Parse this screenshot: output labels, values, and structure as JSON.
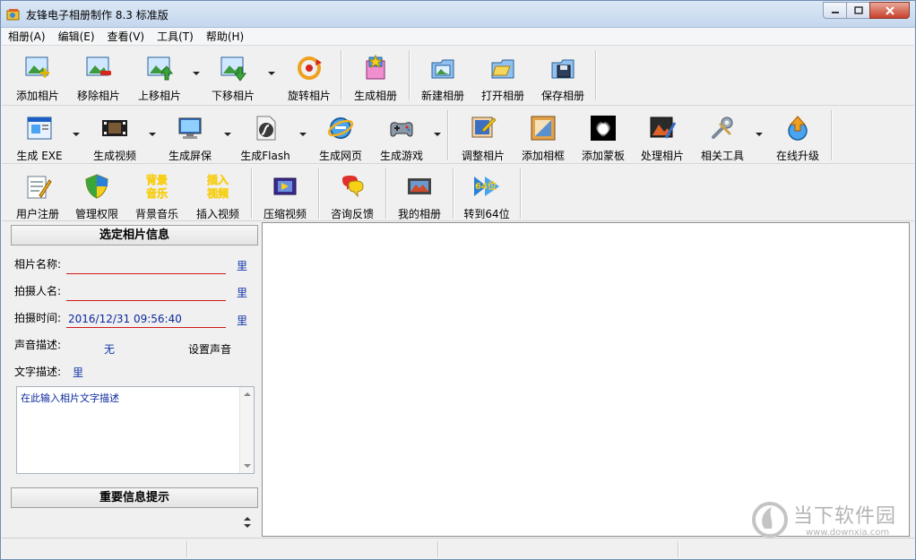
{
  "window": {
    "title": "友锋电子相册制作 8.3 标准版"
  },
  "menu": [
    "相册(A)",
    "编辑(E)",
    "查看(V)",
    "工具(T)",
    "帮助(H)"
  ],
  "toolbar1": {
    "add_photo": "添加相片",
    "remove_photo": "移除相片",
    "move_up": "上移相片",
    "move_down": "下移相片",
    "rotate": "旋转相片",
    "generate_album": "生成相册",
    "new_album": "新建相册",
    "open_album": "打开相册",
    "save_album": "保存相册"
  },
  "toolbar2": {
    "gen_exe": "生成 EXE",
    "gen_video": "生成视频",
    "gen_screensaver": "生成屏保",
    "gen_flash": "生成Flash",
    "gen_webpage": "生成网页",
    "gen_game": "生成游戏",
    "adjust_photo": "调整相片",
    "add_frame": "添加相框",
    "add_mask": "添加蒙板",
    "process_photo": "处理相片",
    "related_tools": "相关工具",
    "online_upgrade": "在线升级"
  },
  "toolbar3": {
    "register": "用户注册",
    "permissions": "管理权限",
    "bg_music": "背景音乐",
    "insert_video": "插入视频",
    "compress_video": "压缩视频",
    "feedback": "咨询反馈",
    "my_album": "我的相册",
    "to_64bit": "转到64位"
  },
  "icon_text": {
    "bg_music_top": "背景",
    "bg_music_bottom": "音乐",
    "insert_video_top": "插入",
    "insert_video_bottom": "视频",
    "bit64": "64位"
  },
  "info_panel": {
    "header": "选定相片信息",
    "name_label": "相片名称:",
    "name_value": "",
    "photographer_label": "拍摄人名:",
    "photographer_value": "",
    "time_label": "拍摄时间:",
    "time_value": "2016/12/31 09:56:40",
    "edit_btn": "里",
    "sound_label": "声音描述:",
    "sound_value": "无",
    "set_sound": "设置声音",
    "text_label": "文字描述:",
    "text_placeholder": "在此输入相片文字描述",
    "tips_header": "重要信息提示"
  },
  "watermark": {
    "title": "当下软件园",
    "url": "www.downxia.com"
  },
  "colors": {
    "accent_blue": "#1133aa",
    "underline_red": "#d11a1a",
    "window_border": "#6f8fb5"
  }
}
